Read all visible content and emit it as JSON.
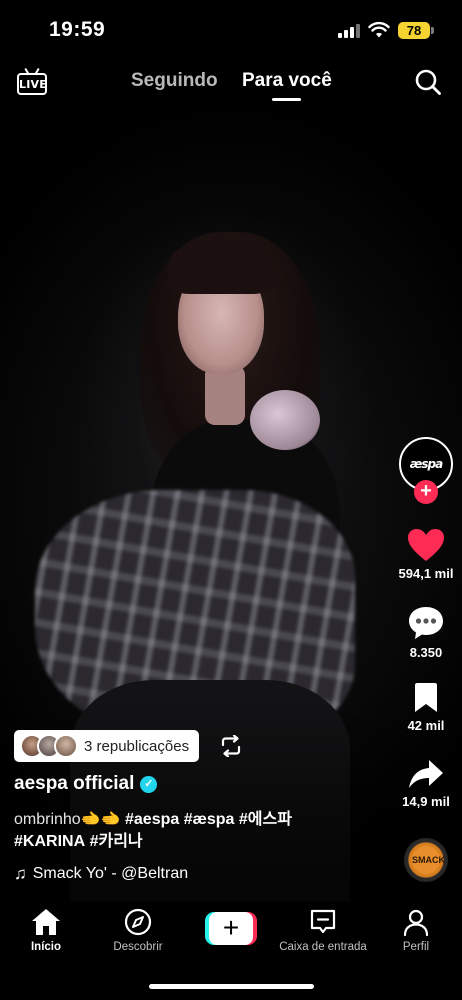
{
  "status_bar": {
    "time": "19:59",
    "battery": "78"
  },
  "top_nav": {
    "live_label": "LIVE",
    "tabs": [
      {
        "label": "Seguindo",
        "active": false
      },
      {
        "label": "Para você",
        "active": true
      }
    ]
  },
  "rail": {
    "avatar_logo": "æspa",
    "likes": "594,1 mil",
    "comments": "8.350",
    "saves": "42 mil",
    "shares": "14,9 mil",
    "disc_label": "SMACK"
  },
  "post": {
    "reposts_label": "3 republicações",
    "author": "aespa official",
    "description": {
      "prefix": "ombrinho🫲🫲 ",
      "hashtags": [
        "#aespa",
        "#æspa",
        "#에스파",
        "#KARINA",
        "#카리나"
      ]
    },
    "sound": "Smack Yo' - @Beltran"
  },
  "bottom_nav": {
    "items": [
      {
        "label": "Início",
        "icon": "home-icon",
        "active": true
      },
      {
        "label": "Descobrir",
        "icon": "compass-icon",
        "active": false
      },
      {
        "label": "+",
        "icon": "plus-icon",
        "active": false
      },
      {
        "label": "Caixa de entrada",
        "icon": "inbox-icon",
        "active": false
      },
      {
        "label": "Perfil",
        "icon": "profile-icon",
        "active": false
      }
    ]
  },
  "colors": {
    "accent": "#fe2c55",
    "cyan": "#25f4ee",
    "battery": "#f5d330",
    "verified": "#20d5ec"
  }
}
